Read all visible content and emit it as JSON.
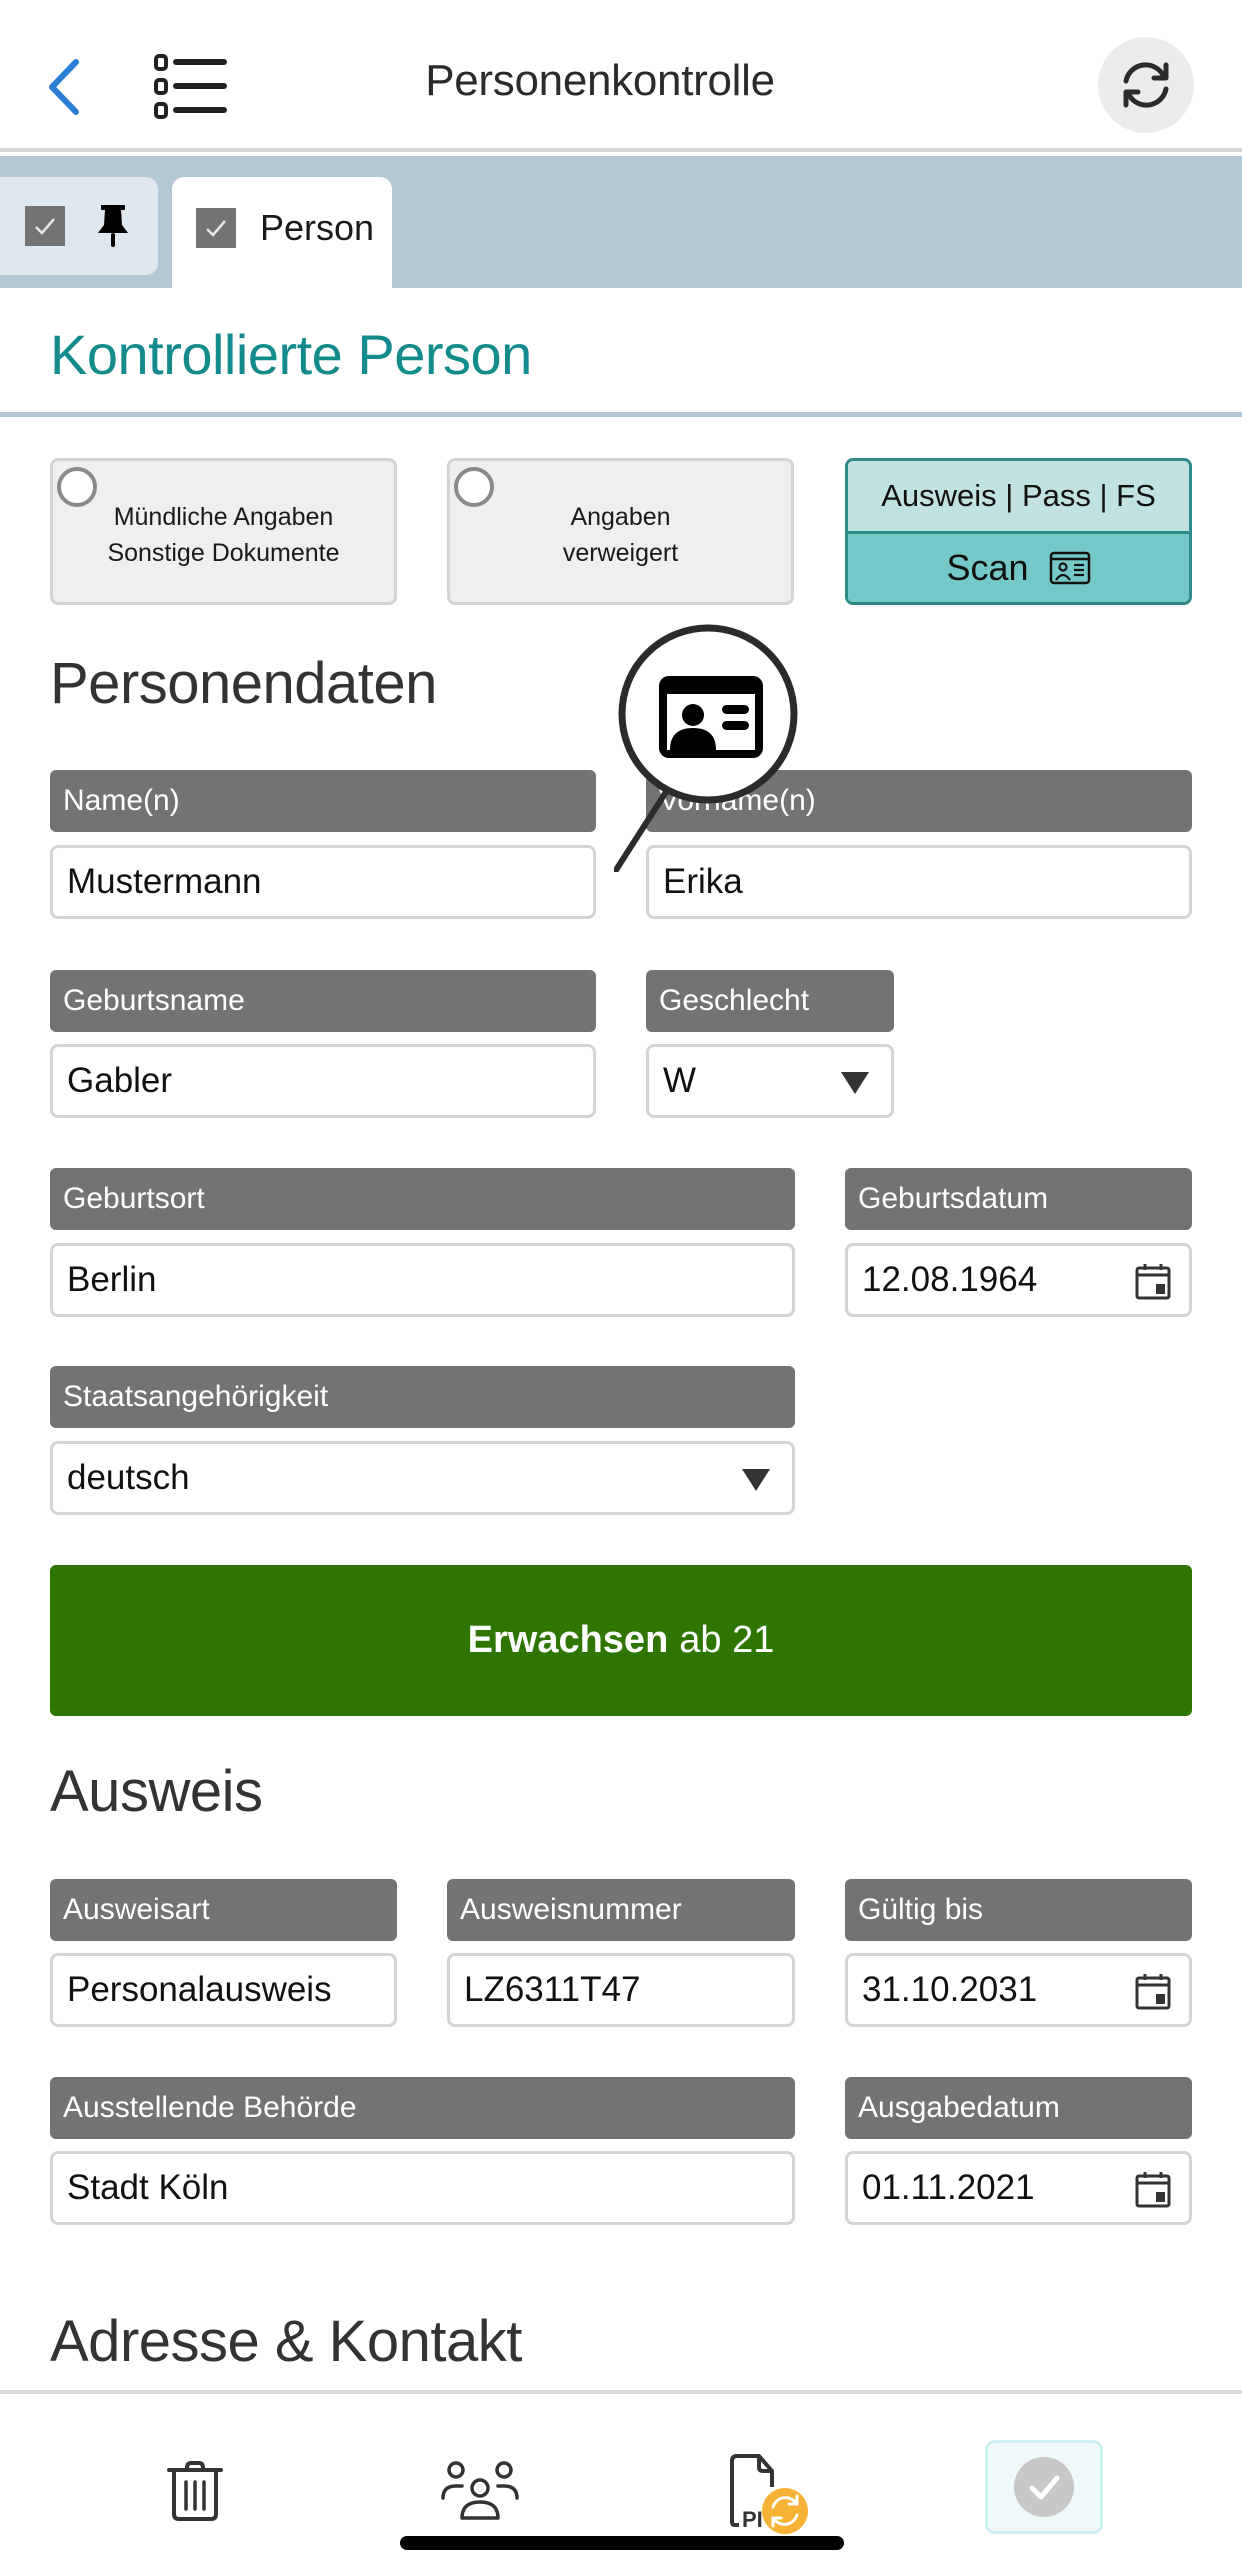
{
  "header": {
    "title": "Personenkontrolle",
    "back_icon": "chevron-left-icon",
    "menu_icon": "list-icon",
    "refresh_icon": "refresh-icon"
  },
  "tabs": [
    {
      "label": "",
      "checked": true,
      "icon": "pin-icon"
    },
    {
      "label": "Person",
      "checked": true,
      "active": true
    }
  ],
  "section": {
    "title": "Kontrollierte Person"
  },
  "options": {
    "oral": {
      "line1": "Mündliche Angaben",
      "line2": "Sonstige Dokumente",
      "selected": false
    },
    "refused": {
      "line1": "Angaben",
      "line2": "verweigert",
      "selected": false
    },
    "scan": {
      "top_label": "Ausweis | Pass | FS",
      "bottom_label": "Scan",
      "icon": "id-card-icon"
    }
  },
  "personendaten": {
    "heading": "Personendaten",
    "fields": {
      "name": {
        "label": "Name(n)",
        "value": "Mustermann"
      },
      "vorname": {
        "label": "Vorname(n)",
        "value": "Erika"
      },
      "geburtsname": {
        "label": "Geburtsname",
        "value": "Gabler"
      },
      "geschlecht": {
        "label": "Geschlecht",
        "value": "W"
      },
      "geburtsort": {
        "label": "Geburtsort",
        "value": "Berlin"
      },
      "geburtsdatum": {
        "label": "Geburtsdatum",
        "value": "12.08.1964"
      },
      "staatsangehoerigkeit": {
        "label": "Staatsangehörigkeit",
        "value": "deutsch"
      }
    },
    "age_status": {
      "bold": "Erwachsen",
      "rest": "ab 21",
      "color": "#2e7501"
    }
  },
  "ausweis": {
    "heading": "Ausweis",
    "fields": {
      "ausweisart": {
        "label": "Ausweisart",
        "value": "Personalausweis"
      },
      "ausweisnummer": {
        "label": "Ausweisnummer",
        "value": "LZ6311T47"
      },
      "gueltig_bis": {
        "label": "Gültig bis",
        "value": "31.10.2031"
      },
      "behoerde": {
        "label": "Ausstellende Behörde",
        "value": "Stadt Köln"
      },
      "ausgabedatum": {
        "label": "Ausgabedatum",
        "value": "01.11.2021"
      }
    }
  },
  "adresse": {
    "heading": "Adresse & Kontakt"
  },
  "bottom_nav": [
    {
      "icon": "trash-icon"
    },
    {
      "icon": "people-icon"
    },
    {
      "icon": "pdf-sync-icon"
    },
    {
      "icon": "confirm-check-icon"
    }
  ],
  "colors": {
    "accent_teal": "#138a8c",
    "tab_bar": "#b3c9d5",
    "label_bg": "#737373",
    "scan_top": "#c2e2e2",
    "scan_bottom": "#74c8c8",
    "status_green": "#2e7501",
    "sync_badge": "#f6b234"
  }
}
